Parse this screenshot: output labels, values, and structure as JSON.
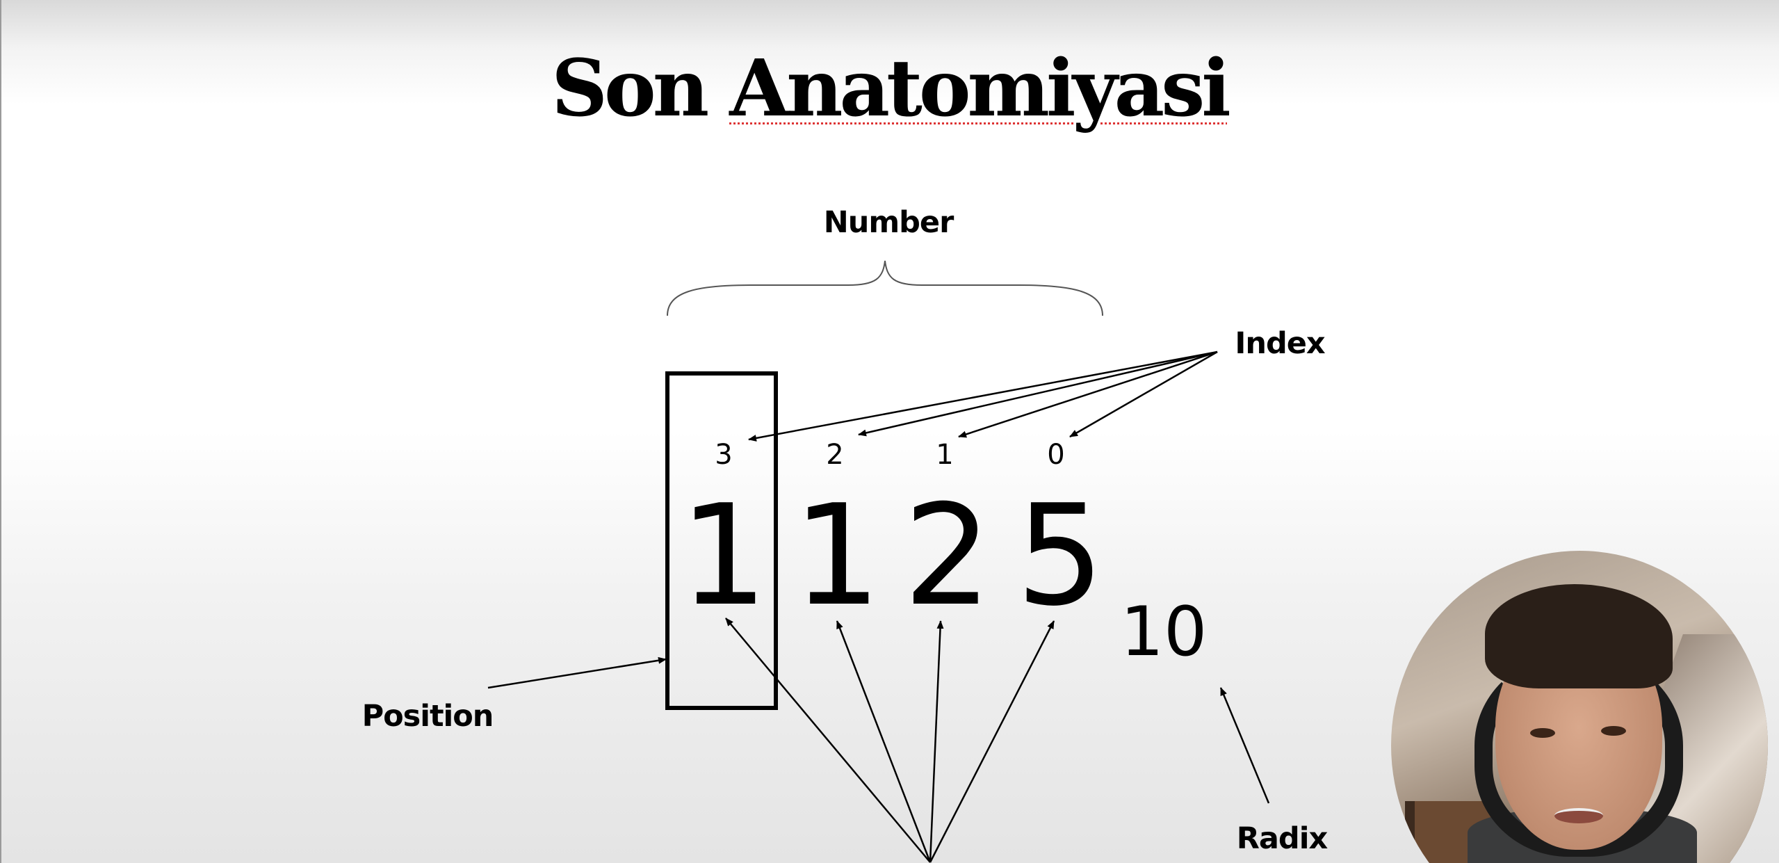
{
  "slide": {
    "title_word1": "Son",
    "title_word2": "Anatomiyasi",
    "labels": {
      "number": "Number",
      "index": "Index",
      "position": "Position",
      "radix": "Radix"
    },
    "indices": [
      "3",
      "2",
      "1",
      "0"
    ],
    "digits": [
      "1",
      "1",
      "2",
      "5"
    ],
    "base": "10"
  },
  "colors": {
    "ink": "#000000",
    "spellcheck_underline": "#dd3333"
  },
  "webcam": {
    "icon": "presenter-webcam-overlay"
  }
}
